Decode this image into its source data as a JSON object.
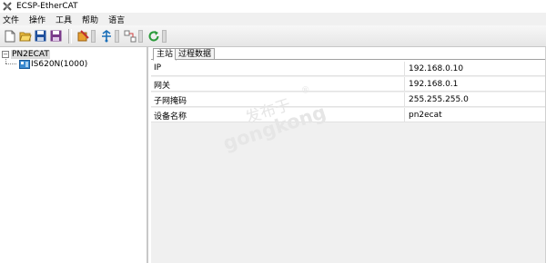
{
  "window": {
    "title": "ECSP-EtherCAT"
  },
  "menu": {
    "items": [
      "文件",
      "操作",
      "工具",
      "帮助",
      "语言"
    ]
  },
  "toolbar": {
    "buttons": [
      "new-file-icon",
      "open-folder-icon",
      "save-icon",
      "save-as-icon",
      "settings-config-icon",
      "network-icon",
      "mapping-icon",
      "refresh-icon"
    ],
    "colors": {
      "save": "#1e4f9c",
      "refresh": "#2a9a3a",
      "network": "#1a6fb8"
    }
  },
  "tree": {
    "root": {
      "label": "PN2ECAT"
    },
    "child": {
      "label": "IS620N(1000)"
    }
  },
  "tabs": [
    {
      "label": "主站",
      "active": true
    },
    {
      "label": "过程数据",
      "active": false
    }
  ],
  "properties": [
    {
      "label": "IP",
      "value": "192.168.0.10"
    },
    {
      "label": "网关",
      "value": "192.168.0.1"
    },
    {
      "label": "子网掩码",
      "value": "255.255.255.0"
    },
    {
      "label": "设备名称",
      "value": "pn2ecat"
    }
  ],
  "watermark": {
    "cn": "发布于",
    "en": "gongkong",
    "reg": "®"
  }
}
